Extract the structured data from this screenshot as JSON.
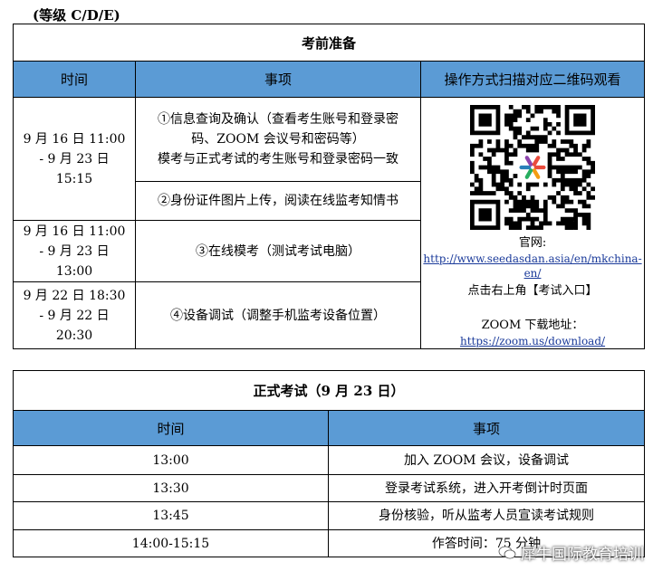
{
  "level": "(等级 C/D/E)",
  "prep": {
    "title": "考前准备",
    "headers": [
      "时间",
      "事项",
      "操作方式扫描对应二维码观看"
    ],
    "rows": [
      {
        "time": "9 月 16 日 11:00 - 9 月 23 日 15:15",
        "item_a": "①信息查询及确认（查看考生账号和登录密码、ZOOM 会议号和密码等）",
        "item_b": "模考与正式考试的考生账号和登录密码一致"
      },
      {
        "item": "②身份证件图片上传，阅读在线监考知情书"
      },
      {
        "time": "9 月 16 日 11:00 - 9 月 23 日 13:00",
        "item": "③在线模考（测试考试电脑）"
      },
      {
        "time": "9 月 22 日 18:30 - 9 月 22 日 20:30",
        "item": "④设备调试（调整手机监考设备位置）"
      }
    ],
    "qr_icon": "qr-code-icon",
    "official_label": "官网:",
    "official_url": "http://www.seedasdan.asia/en/mkchina-en/",
    "official_hint": "点击右上角【考试入口】",
    "zoom_label": "ZOOM 下载地址：",
    "zoom_url": "https://zoom.us/download/"
  },
  "exam": {
    "title": "正式考试（9 月 23 日）",
    "headers": [
      "时间",
      "事项"
    ],
    "rows": [
      {
        "time": "13:00",
        "item": "加入 ZOOM 会议，设备调试"
      },
      {
        "time": "13:30",
        "item": "登录考试系统，进入开考倒计时页面"
      },
      {
        "time": "13:45",
        "item": "身份核验，听从监考人员宣读考试规则"
      },
      {
        "time": "14:00-15:15",
        "item": "作答时间：75 分钟"
      }
    ]
  },
  "watermark": "犀牛国际教育培训",
  "colors": {
    "header_bg": "#5b9bd5",
    "link": "#1a3a9a"
  }
}
